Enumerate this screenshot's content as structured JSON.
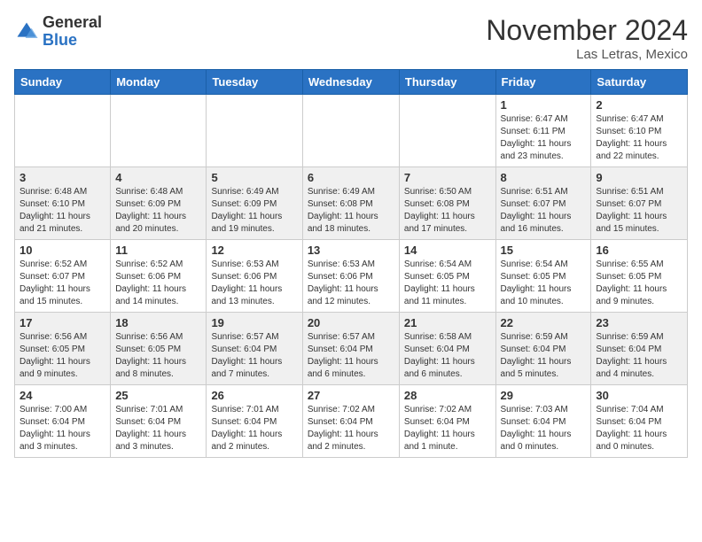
{
  "header": {
    "logo_general": "General",
    "logo_blue": "Blue",
    "month_title": "November 2024",
    "location": "Las Letras, Mexico"
  },
  "days_of_week": [
    "Sunday",
    "Monday",
    "Tuesday",
    "Wednesday",
    "Thursday",
    "Friday",
    "Saturday"
  ],
  "weeks": [
    [
      {
        "day": "",
        "info": ""
      },
      {
        "day": "",
        "info": ""
      },
      {
        "day": "",
        "info": ""
      },
      {
        "day": "",
        "info": ""
      },
      {
        "day": "",
        "info": ""
      },
      {
        "day": "1",
        "info": "Sunrise: 6:47 AM\nSunset: 6:11 PM\nDaylight: 11 hours and 23 minutes."
      },
      {
        "day": "2",
        "info": "Sunrise: 6:47 AM\nSunset: 6:10 PM\nDaylight: 11 hours and 22 minutes."
      }
    ],
    [
      {
        "day": "3",
        "info": "Sunrise: 6:48 AM\nSunset: 6:10 PM\nDaylight: 11 hours and 21 minutes."
      },
      {
        "day": "4",
        "info": "Sunrise: 6:48 AM\nSunset: 6:09 PM\nDaylight: 11 hours and 20 minutes."
      },
      {
        "day": "5",
        "info": "Sunrise: 6:49 AM\nSunset: 6:09 PM\nDaylight: 11 hours and 19 minutes."
      },
      {
        "day": "6",
        "info": "Sunrise: 6:49 AM\nSunset: 6:08 PM\nDaylight: 11 hours and 18 minutes."
      },
      {
        "day": "7",
        "info": "Sunrise: 6:50 AM\nSunset: 6:08 PM\nDaylight: 11 hours and 17 minutes."
      },
      {
        "day": "8",
        "info": "Sunrise: 6:51 AM\nSunset: 6:07 PM\nDaylight: 11 hours and 16 minutes."
      },
      {
        "day": "9",
        "info": "Sunrise: 6:51 AM\nSunset: 6:07 PM\nDaylight: 11 hours and 15 minutes."
      }
    ],
    [
      {
        "day": "10",
        "info": "Sunrise: 6:52 AM\nSunset: 6:07 PM\nDaylight: 11 hours and 15 minutes."
      },
      {
        "day": "11",
        "info": "Sunrise: 6:52 AM\nSunset: 6:06 PM\nDaylight: 11 hours and 14 minutes."
      },
      {
        "day": "12",
        "info": "Sunrise: 6:53 AM\nSunset: 6:06 PM\nDaylight: 11 hours and 13 minutes."
      },
      {
        "day": "13",
        "info": "Sunrise: 6:53 AM\nSunset: 6:06 PM\nDaylight: 11 hours and 12 minutes."
      },
      {
        "day": "14",
        "info": "Sunrise: 6:54 AM\nSunset: 6:05 PM\nDaylight: 11 hours and 11 minutes."
      },
      {
        "day": "15",
        "info": "Sunrise: 6:54 AM\nSunset: 6:05 PM\nDaylight: 11 hours and 10 minutes."
      },
      {
        "day": "16",
        "info": "Sunrise: 6:55 AM\nSunset: 6:05 PM\nDaylight: 11 hours and 9 minutes."
      }
    ],
    [
      {
        "day": "17",
        "info": "Sunrise: 6:56 AM\nSunset: 6:05 PM\nDaylight: 11 hours and 9 minutes."
      },
      {
        "day": "18",
        "info": "Sunrise: 6:56 AM\nSunset: 6:05 PM\nDaylight: 11 hours and 8 minutes."
      },
      {
        "day": "19",
        "info": "Sunrise: 6:57 AM\nSunset: 6:04 PM\nDaylight: 11 hours and 7 minutes."
      },
      {
        "day": "20",
        "info": "Sunrise: 6:57 AM\nSunset: 6:04 PM\nDaylight: 11 hours and 6 minutes."
      },
      {
        "day": "21",
        "info": "Sunrise: 6:58 AM\nSunset: 6:04 PM\nDaylight: 11 hours and 6 minutes."
      },
      {
        "day": "22",
        "info": "Sunrise: 6:59 AM\nSunset: 6:04 PM\nDaylight: 11 hours and 5 minutes."
      },
      {
        "day": "23",
        "info": "Sunrise: 6:59 AM\nSunset: 6:04 PM\nDaylight: 11 hours and 4 minutes."
      }
    ],
    [
      {
        "day": "24",
        "info": "Sunrise: 7:00 AM\nSunset: 6:04 PM\nDaylight: 11 hours and 3 minutes."
      },
      {
        "day": "25",
        "info": "Sunrise: 7:01 AM\nSunset: 6:04 PM\nDaylight: 11 hours and 3 minutes."
      },
      {
        "day": "26",
        "info": "Sunrise: 7:01 AM\nSunset: 6:04 PM\nDaylight: 11 hours and 2 minutes."
      },
      {
        "day": "27",
        "info": "Sunrise: 7:02 AM\nSunset: 6:04 PM\nDaylight: 11 hours and 2 minutes."
      },
      {
        "day": "28",
        "info": "Sunrise: 7:02 AM\nSunset: 6:04 PM\nDaylight: 11 hours and 1 minute."
      },
      {
        "day": "29",
        "info": "Sunrise: 7:03 AM\nSunset: 6:04 PM\nDaylight: 11 hours and 0 minutes."
      },
      {
        "day": "30",
        "info": "Sunrise: 7:04 AM\nSunset: 6:04 PM\nDaylight: 11 hours and 0 minutes."
      }
    ]
  ]
}
